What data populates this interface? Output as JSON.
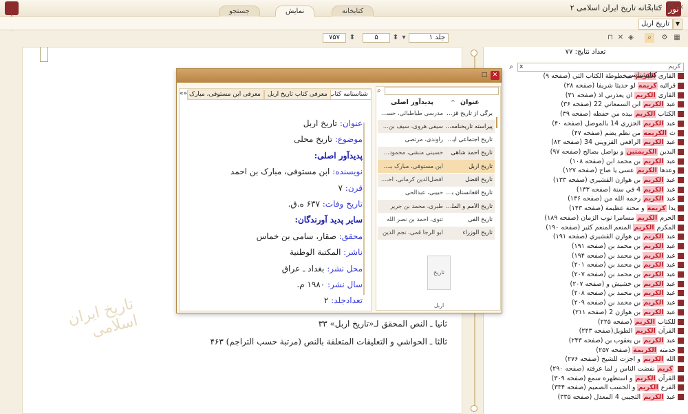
{
  "app": {
    "title": "کتابخانه تاریخ ایران اسلامی ۲",
    "logo": "نور"
  },
  "window_controls": [
    "?",
    "–",
    "□",
    "×"
  ],
  "tabs": [
    "کتابخانه",
    "نمایش",
    "جستجو"
  ],
  "toolbar": {
    "book_name": "تاریخ اربل"
  },
  "nav": {
    "volume_label": "جلد ۱",
    "page": "۵",
    "total_pages": "۷۵۷"
  },
  "reader": {
    "lines": [
      "ثانیا ـ النص المحقق لـ«تاریخ اربل» ۳۳",
      "ثالثا ـ الحواشي و التعليقات المتعلقة بالنص (مرتبة حسب التراجم) ۴۶۳"
    ],
    "watermark": "تاریخ ایران اسلامی"
  },
  "results": {
    "count_text": "تعداد نتایج: ۷۷",
    "search_value": "کریم",
    "search_clear": "x",
    "items": [
      {
        "pre": "القاری",
        "kw": "الکریم",
        "post": "بمخطوطة الكتاب التي (صفحه ۹)"
      },
      {
        "pre": "قرائيه",
        "kw": "كريمه",
        "post": "لو حديثا شريفا (صفحه ۲۸)"
      },
      {
        "pre": "القاری",
        "kw": "الکریم",
        "post": "ان يعذرني اذ (صفحه ۳۱)"
      },
      {
        "pre": "عبد",
        "kw": "الكريم",
        "post": "ابن السمعاني 22 (صفحه ۳۶)"
      },
      {
        "pre": "الکتاب",
        "kw": "الکریم",
        "post": "بيده من حفظه (صفحه ۳۹)"
      },
      {
        "pre": "عبد",
        "kw": "الكريم",
        "post": "الجزري 14 بالموصل (صفحه ۴۰)"
      },
      {
        "pre": "ث",
        "kw": "الكريمه",
        "post": "من نظم يضم (صفحه ۴۷)"
      },
      {
        "pre": "عبد",
        "kw": "الكريم",
        "post": "الرافعي القزويني 34 (صفحه ۸۲)"
      },
      {
        "pre": "البدين",
        "kw": "الكريمتين",
        "post": "و يواصل بصالح (صفحه ۹۷)"
      },
      {
        "pre": "عبد",
        "kw": "الكريم",
        "post": "بن محمد ابن (صفحه ۱۰۸)"
      },
      {
        "pre": "وعدها",
        "kw": "الكريم",
        "post": "عسى يا صاح (صفحه ۱۲۷)"
      },
      {
        "pre": "عبد",
        "kw": "الكريم",
        "post": "بن هوازن القشيري (صفحه ۱۳۳)"
      },
      {
        "pre": "عبد",
        "kw": "الكريم",
        "post": "4 في سنة (صفحه ۱۳۳)"
      },
      {
        "pre": "عبد",
        "kw": "الكريم",
        "post": "رحمه الله من (صفحه ۱۳۶)"
      },
      {
        "pre": "يدا",
        "kw": "كريمة",
        "post": "و محنة عظيمة (صفحه ۱۴۳)"
      },
      {
        "pre": "الحرم",
        "kw": "الكريم",
        "post": "مسامرا نوب الزمان (صفحه ۱۸۹)"
      },
      {
        "pre": "المكرم",
        "kw": "الكريم",
        "post": "المنعم المنعم كثير (صفحه ۱۹۰)"
      },
      {
        "pre": "عبد",
        "kw": "الكريم",
        "post": "بن هوازن القشيري (صفحه ۱۹۱)"
      },
      {
        "pre": "عبد",
        "kw": "الكريم",
        "post": "بن محمد بن (صفحه ۱۹۱)"
      },
      {
        "pre": "عبد",
        "kw": "الكريم",
        "post": "بن محمد بن (صفحه ۱۹۴)"
      },
      {
        "pre": "عبد",
        "kw": "الكريم",
        "post": "بن محمد بن (صفحه ۲۰۱)"
      },
      {
        "pre": "عبد",
        "kw": "الكريم",
        "post": "بن محمد بن (صفحه ۲۰۷)"
      },
      {
        "pre": "عبد",
        "kw": "الكريم",
        "post": "بن خشيش و (صفحه ۲۰۷)"
      },
      {
        "pre": "عبد",
        "kw": "الكريم",
        "post": "بن محمد بن (صفحه ۲۰۸)"
      },
      {
        "pre": "عبد",
        "kw": "الكريم",
        "post": "بن محمد بن (صفحه ۲۰۹)"
      },
      {
        "pre": "عبد",
        "kw": "الكريم",
        "post": "بن هوازن 2 (صفحه ۲۱۱)"
      },
      {
        "pre": "للكتاب",
        "kw": "الكريم",
        "post": "(صفحه ۲۲۵)"
      },
      {
        "pre": "القرآن",
        "kw": "الكريم",
        "post": "الطويل(صفحه ۲۴۳)"
      },
      {
        "pre": "عبد",
        "kw": "الكريم",
        "post": "بن يعقوب بن (صفحه ۲۴۳)"
      },
      {
        "pre": "خدمته",
        "kw": "الكريمة",
        "post": "(صفحه ۲۵۷)"
      },
      {
        "pre": "الله",
        "kw": "الكريم",
        "post": "و اجزت للشيخ (صفحه ۲۷۶)"
      },
      {
        "pre": "",
        "kw": "كريم",
        "post": "نفضت الناس ز لما عرفته (صفحه ۲۹۰)"
      },
      {
        "pre": "القرآن",
        "kw": "الكريم",
        "post": "و استظهره سمع (صفحه ۳۰۹)"
      },
      {
        "pre": "الفرع",
        "kw": "الكريم",
        "post": "و الحسب الصميم (صفحه ۳۳۴)"
      },
      {
        "pre": "عبد",
        "kw": "الكريم",
        "post": "التجيبي 4 المعدل (صفحه ۳۳۵)"
      }
    ]
  },
  "dialog": {
    "title": "کتابشناسی",
    "tabs": [
      "شناسنامه کتاب",
      "معرفی کتاب تاریخ اربل",
      "معرفی ابن مستوفی، مبارک بن"
    ],
    "card": [
      {
        "label": "عنوان: ",
        "value": "تاریخ اربل"
      },
      {
        "label": "موضوع: ",
        "value": "تاریخ محلی"
      },
      {
        "heading": "پدیدآور اصلی:"
      },
      {
        "label": "نویسنده: ",
        "value": "ابن مستوفی، مبارک بن احمد"
      },
      {
        "label": "قرن: ",
        "value": "۷"
      },
      {
        "label": "تاریخ وفات: ",
        "value": "۶۳۷ ه.ق."
      },
      {
        "heading": "سایر پدید آورندگان:"
      },
      {
        "label": "محقق: ",
        "value": "صقار، سامی بن خماس"
      },
      {
        "label": "ناشر: ",
        "value": "المکتبة الوطنیة"
      },
      {
        "label": "محل نشر: ",
        "value": "بغداد ـ عراق"
      },
      {
        "label": "سال نشر: ",
        "value": "۱۹۸۰ م."
      },
      {
        "label": "تعدادجلد: ",
        "value": "۲"
      }
    ],
    "list_headers": {
      "title": "عنوان",
      "author": "پدیدآور اصلی"
    },
    "rows": [
      {
        "title": "برگی از تاریخ قزوین",
        "author": "مدرسی طباطبائی، حسـ..."
      },
      {
        "title": "پیراسته تاریخنامه هرات",
        "author": "سیفی هروی، سیف بن..."
      },
      {
        "title": "تاریخ اجتماعی ایران",
        "author": "راوندی، مرتضی"
      },
      {
        "title": "تاریخ احمد شاهی",
        "author": "حسینی منشی، محمود..."
      },
      {
        "title": "تاریخ اربل",
        "author": "ابن مستوفی، مبارک بـ..."
      },
      {
        "title": "تاریخ أفضل",
        "author": "افضل‌الدین کرمانی، احـ..."
      },
      {
        "title": "تاریخ افغانستان بعد از...",
        "author": "حبیبی، عبدالحی"
      },
      {
        "title": "تاریخ الأمم و الملوک",
        "author": "طبری، محمد بن جریر"
      },
      {
        "title": "تاریخ الفی",
        "author": "تتوی، احمد بن نصر الله"
      },
      {
        "title": "تاریخ الوزراء",
        "author": "ابو الرجا قمی، نجم الدین"
      }
    ],
    "selected_row": 4,
    "thumb_text": "تاریخ اربل"
  }
}
